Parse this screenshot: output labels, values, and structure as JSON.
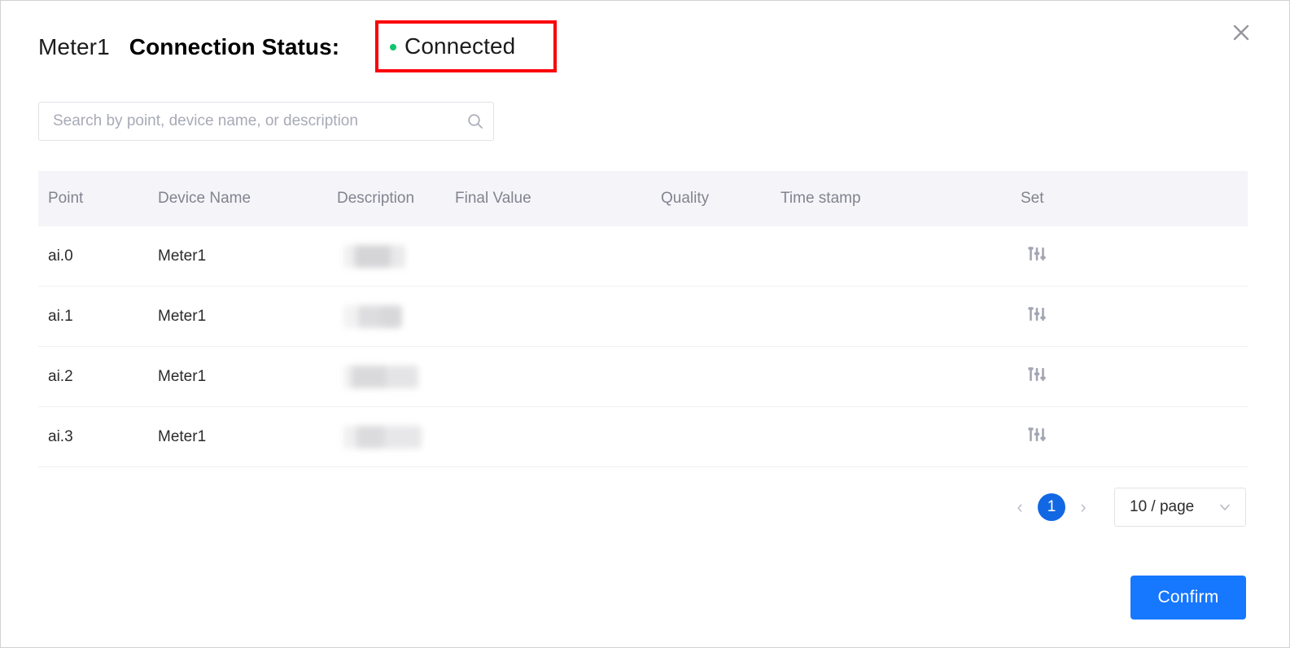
{
  "dialog": {
    "device_name": "Meter1",
    "status_label": "Connection Status:",
    "status_value": "Connected",
    "status_dot_color": "#12c46a",
    "highlight_color": "#fb0007",
    "close_icon": "close-icon"
  },
  "search": {
    "value": "",
    "placeholder": "Search by point, device name, or description",
    "icon": "search-icon"
  },
  "table": {
    "columns": [
      "Point",
      "Device Name",
      "Description",
      "Final Value",
      "Quality",
      "Time stamp",
      "Set"
    ],
    "rows": [
      {
        "point": "ai.0",
        "device_name": "Meter1",
        "description": "",
        "final_value": "",
        "quality": "",
        "time_stamp": "",
        "set_icon": "sliders-icon"
      },
      {
        "point": "ai.1",
        "device_name": "Meter1",
        "description": "",
        "final_value": "",
        "quality": "",
        "time_stamp": "",
        "set_icon": "sliders-icon"
      },
      {
        "point": "ai.2",
        "device_name": "Meter1",
        "description": "",
        "final_value": "",
        "quality": "",
        "time_stamp": "",
        "set_icon": "sliders-icon"
      },
      {
        "point": "ai.3",
        "device_name": "Meter1",
        "description": "",
        "final_value": "",
        "quality": "",
        "time_stamp": "",
        "set_icon": "sliders-icon"
      }
    ]
  },
  "pagination": {
    "prev_label": "‹",
    "next_label": "›",
    "current_page": "1",
    "page_size_label": "10 / page",
    "caret_icon": "chevron-down-icon"
  },
  "footer": {
    "confirm_label": "Confirm",
    "confirm_color": "#1677ff"
  }
}
